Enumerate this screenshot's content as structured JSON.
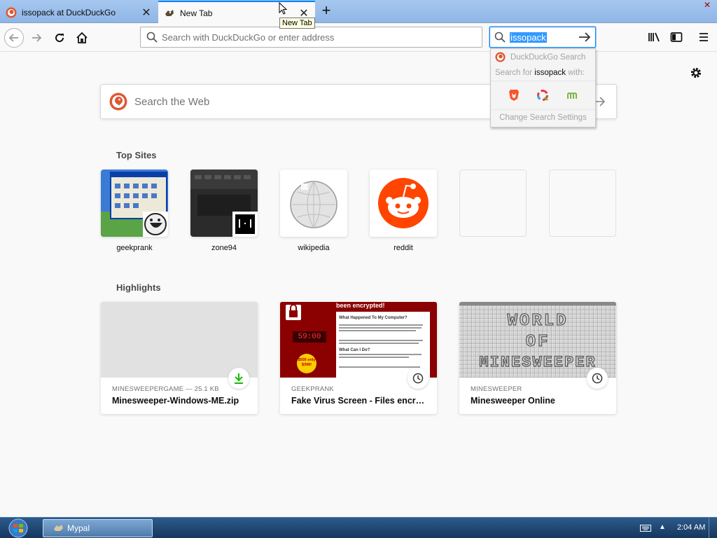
{
  "tabs": [
    {
      "title": "issopack at DuckDuckGo",
      "active": false
    },
    {
      "title": "New Tab",
      "active": true
    }
  ],
  "tooltip": "New Tab",
  "urlbar": {
    "placeholder": "Search with DuckDuckGo or enter address"
  },
  "searchbar": {
    "value": "issopack"
  },
  "search_popup": {
    "engine_name": "DuckDuckGo Search",
    "search_for_prefix": "Search for",
    "search_term": "issopack",
    "search_for_suffix": "with:",
    "one_off_engines": [
      "brave-icon",
      "qwant-icon",
      "mojeek-icon"
    ],
    "settings_label": "Change Search Settings"
  },
  "web_search": {
    "placeholder": "Search the Web"
  },
  "top_sites": {
    "title": "Top Sites",
    "items": [
      {
        "label": "geekprank"
      },
      {
        "label": "zone94"
      },
      {
        "label": "wikipedia"
      },
      {
        "label": "reddit"
      },
      {
        "label": ""
      },
      {
        "label": ""
      }
    ]
  },
  "highlights": {
    "title": "Highlights",
    "cards": [
      {
        "context": "MINESWEEPERGAME — 25.1 KB",
        "title": "Minesweeper-Windows-ME.zip",
        "badge": "download-icon"
      },
      {
        "context": "GEEKPRANK",
        "title": "Fake Virus Screen - Files encrypted",
        "badge": "clock-icon",
        "thumb_text": {
          "headline": "been encrypted!",
          "section1": "What Happened To My Computer?",
          "countdown": "59:00",
          "section2": "What Can I Do?",
          "offer": "$500 only $399!"
        }
      },
      {
        "context": "MINESWEEPER",
        "title": "Minesweeper Online",
        "badge": "clock-icon",
        "thumb_text": {
          "line1": "WORLD",
          "line2": "OF",
          "line3": "MINESWEEPER"
        }
      }
    ]
  },
  "taskbar": {
    "app_label": "Mypal",
    "time": "2:04 AM"
  },
  "colors": {
    "accent": "#0a84ff",
    "selection": "#3399ff",
    "reddit": "#ff4500",
    "ddg": "#de5833",
    "download": "#12bc00",
    "virus_red": "#a40000"
  }
}
